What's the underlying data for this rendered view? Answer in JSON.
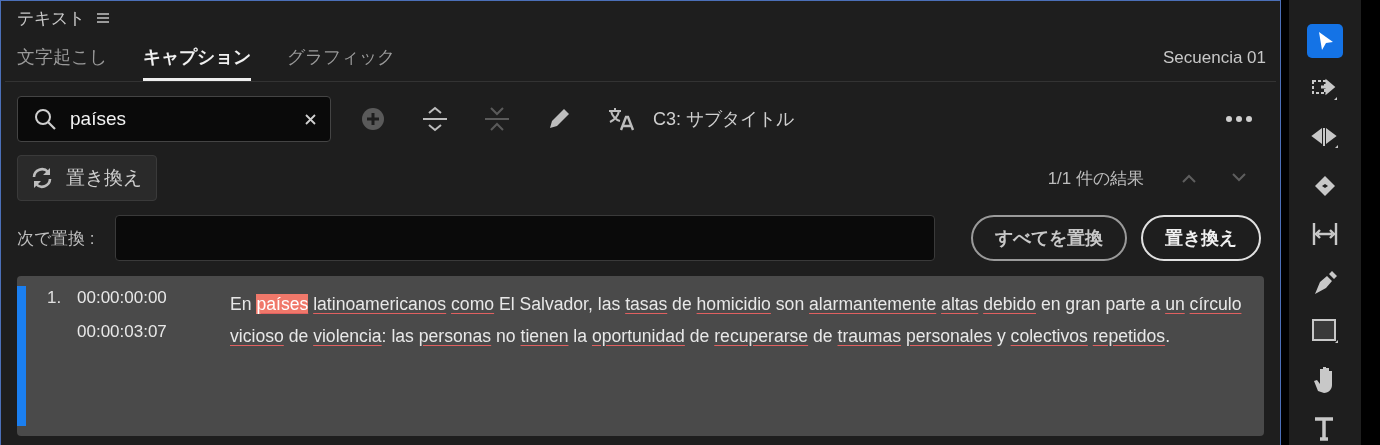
{
  "panel": {
    "title": "テキスト"
  },
  "tabs": [
    {
      "label": "文字起こし",
      "selected": false
    },
    {
      "label": "キャプション",
      "selected": true
    },
    {
      "label": "グラフィック",
      "selected": false
    }
  ],
  "sequence": "Secuencia 01",
  "search": {
    "value": "países"
  },
  "toolbar": [
    {
      "kind": "add",
      "disabled": true
    },
    {
      "kind": "expand",
      "disabled": false
    },
    {
      "kind": "collapse",
      "disabled": true
    },
    {
      "kind": "edit",
      "disabled": false
    },
    {
      "kind": "translate",
      "disabled": false
    }
  ],
  "track": "C3: サブタイトル",
  "replace_toggle": "置き換え",
  "results": {
    "text": "1/1 件の結果",
    "prev_disabled": true,
    "next_disabled": true
  },
  "replace_with": {
    "label": "次で置換 :"
  },
  "buttons": [
    "すべてを置換",
    "置き換え"
  ],
  "captions": [
    {
      "number": "1.",
      "start": "00:00:00:00",
      "end": "00:00:03:07",
      "selected": true,
      "segments": [
        {
          "text": "En",
          "kind": "plain"
        },
        {
          "text": "países",
          "kind": "match"
        },
        {
          "text": "latinoamericanos",
          "kind": "flagged"
        },
        {
          "text": "como",
          "kind": "flagged"
        },
        {
          "text": "El Salvador, las",
          "kind": "plain"
        },
        {
          "text": "tasas",
          "kind": "flagged"
        },
        {
          "text": "de",
          "kind": "plain"
        },
        {
          "text": "homicidio",
          "kind": "flagged"
        },
        {
          "text": "son",
          "kind": "plain"
        },
        {
          "text": "alarmantemente",
          "kind": "flagged"
        },
        {
          "text": "altas",
          "kind": "flagged"
        },
        {
          "text": "debido",
          "kind": "flagged"
        },
        {
          "text": "en gran parte a",
          "kind": "plain"
        },
        {
          "text": "un",
          "kind": "flagged"
        },
        {
          "text": "círculo",
          "kind": "flagged"
        },
        {
          "text": "vicioso",
          "kind": "flagged"
        },
        {
          "text": "de",
          "kind": "plain"
        },
        {
          "text": "violencia",
          "kind": "flagged",
          "punct": ":"
        },
        {
          "text": "las",
          "kind": "plain"
        },
        {
          "text": "personas",
          "kind": "flagged"
        },
        {
          "text": "no",
          "kind": "plain"
        },
        {
          "text": "tienen",
          "kind": "flagged"
        },
        {
          "text": "la",
          "kind": "plain"
        },
        {
          "text": "oportunidad",
          "kind": "flagged"
        },
        {
          "text": "de",
          "kind": "plain"
        },
        {
          "text": "recuperarse",
          "kind": "flagged"
        },
        {
          "text": "de",
          "kind": "plain"
        },
        {
          "text": "traumas",
          "kind": "flagged"
        },
        {
          "text": "personales",
          "kind": "flagged"
        },
        {
          "text": "y",
          "kind": "plain"
        },
        {
          "text": "colectivos",
          "kind": "flagged"
        },
        {
          "text": "repetidos",
          "kind": "flagged",
          "punct": "."
        }
      ]
    }
  ],
  "tools": [
    {
      "kind": "select",
      "selected": true
    },
    {
      "kind": "track-select",
      "selected": false
    },
    {
      "kind": "ripple",
      "selected": false
    },
    {
      "kind": "razor",
      "selected": false
    },
    {
      "kind": "slip",
      "selected": false
    },
    {
      "kind": "pen",
      "selected": false
    },
    {
      "kind": "rectangle",
      "selected": false
    },
    {
      "kind": "hand",
      "selected": false
    },
    {
      "kind": "type",
      "selected": false
    }
  ]
}
